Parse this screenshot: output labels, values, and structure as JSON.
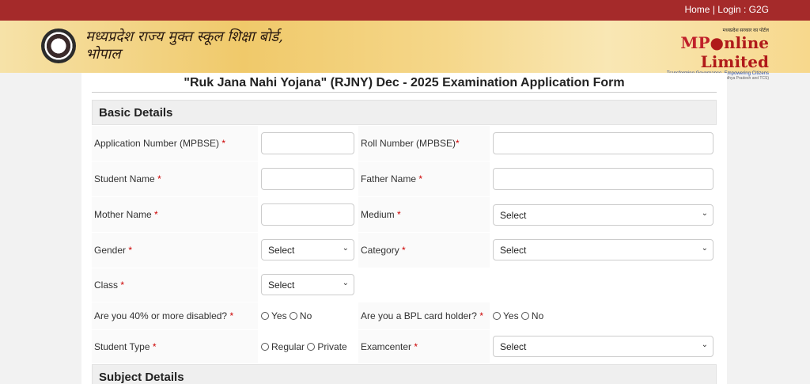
{
  "topbar": {
    "home": "Home",
    "sep": " | ",
    "login": "Login : G2G"
  },
  "header": {
    "board_line1": "मध्यप्रदेश राज्य मुक्त स्कूल शिक्षा बोर्ड,",
    "board_line2": "भोपाल",
    "mp_tagline": "मध्यप्रदेश सरकार का पोर्टल",
    "mp_title_mp": "MP",
    "mp_title_rest": "nline Limited",
    "mp_sub": "Transforming Governance, Empowering Citizens",
    "mp_sub2": "(Joint venture between Govt of Madhya Pradesh and TCS)"
  },
  "form": {
    "title": "\"Ruk Jana Nahi Yojana\" (RJNY) Dec - 2025 Examination Application Form",
    "basic_details": "Basic Details",
    "subject_details": "Subject Details",
    "req": "*",
    "fields": {
      "application_number": "Application Number (MPBSE)",
      "roll_number": "Roll Number (MPBSE)",
      "student_name": "Student Name",
      "father_name": "Father Name",
      "mother_name": "Mother Name",
      "medium": "Medium",
      "gender": "Gender",
      "category": "Category",
      "class": "Class",
      "disabled": "Are you 40% or more disabled?",
      "bpl": "Are you a BPL card holder?",
      "student_type": "Student Type",
      "examcenter": "Examcenter"
    },
    "select_placeholder": "Select",
    "yes": "Yes",
    "no": "No",
    "regular": "Regular",
    "private": "Private"
  }
}
